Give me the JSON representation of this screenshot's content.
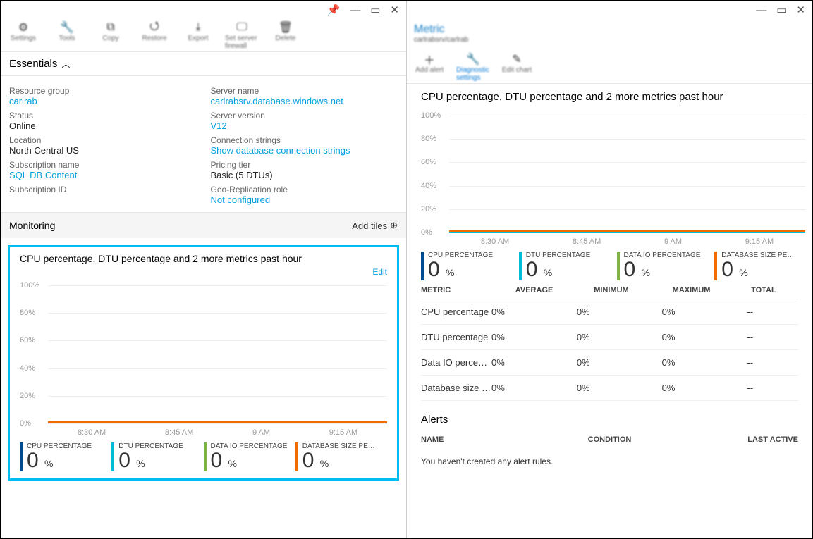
{
  "left": {
    "toolbar": [
      {
        "label": "Settings",
        "icon": "⚙"
      },
      {
        "label": "Tools",
        "icon": "🔧"
      },
      {
        "label": "Copy",
        "icon": "⧉"
      },
      {
        "label": "Restore",
        "icon": "⭯"
      },
      {
        "label": "Export",
        "icon": "⤓"
      },
      {
        "label": "Set server firewall",
        "icon": "🖵"
      },
      {
        "label": "Delete",
        "icon": "🗑"
      }
    ],
    "essentials_label": "Essentials",
    "essentials": {
      "left": [
        {
          "label": "Resource group",
          "value": "carlrab",
          "link": true
        },
        {
          "label": "Status",
          "value": "Online"
        },
        {
          "label": "Location",
          "value": "North Central US"
        },
        {
          "label": "Subscription name",
          "value": "SQL DB Content",
          "link": true
        },
        {
          "label": "Subscription ID",
          "value": ""
        }
      ],
      "right": [
        {
          "label": "Server name",
          "value": "carlrabsrv.database.windows.net",
          "link": true
        },
        {
          "label": "Server version",
          "value": "V12",
          "link": true
        },
        {
          "label": "Connection strings",
          "value": "Show database connection strings",
          "link": true
        },
        {
          "label": "Pricing tier",
          "value": "Basic (5 DTUs)"
        },
        {
          "label": "Geo-Replication role",
          "value": "Not configured",
          "link": true
        }
      ]
    },
    "monitoring_label": "Monitoring",
    "add_tiles": "Add tiles",
    "chart_tile_title": "CPU percentage, DTU percentage and 2 more metrics past hour",
    "edit": "Edit"
  },
  "right": {
    "blade_title": "Metric",
    "blade_sub": "carlrabsrv/carlrab",
    "toolbar": [
      {
        "label": "Add alert",
        "icon": "＋",
        "active": false
      },
      {
        "label": "Diagnostic settings",
        "icon": "🔧",
        "active": true
      },
      {
        "label": "Edit chart",
        "icon": "✎",
        "active": false
      }
    ],
    "chart_title": "CPU percentage, DTU percentage and 2 more metrics past hour",
    "table": {
      "headers": [
        "METRIC",
        "AVERAGE",
        "MINIMUM",
        "MAXIMUM",
        "TOTAL"
      ],
      "rows": [
        [
          "CPU percentage",
          "0%",
          "0%",
          "0%",
          "--"
        ],
        [
          "DTU percentage",
          "0%",
          "0%",
          "0%",
          "--"
        ],
        [
          "Data IO percenta...",
          "0%",
          "0%",
          "0%",
          "--"
        ],
        [
          "Database size pe...",
          "0%",
          "0%",
          "0%",
          "--"
        ]
      ]
    },
    "alerts_label": "Alerts",
    "alerts_headers": [
      "NAME",
      "CONDITION",
      "LAST ACTIVE"
    ],
    "alerts_empty": "You haven't created any alert rules."
  },
  "chart_data": {
    "type": "line",
    "title": "CPU percentage, DTU percentage and 2 more metrics past hour",
    "ylabel": "%",
    "ylim": [
      0,
      100
    ],
    "yticks": [
      "0%",
      "20%",
      "40%",
      "60%",
      "80%",
      "100%"
    ],
    "x": [
      "8:30 AM",
      "8:45 AM",
      "9 AM",
      "9:15 AM"
    ],
    "series": [
      {
        "name": "CPU PERCENTAGE",
        "color": "#004b8d",
        "current": "0",
        "unit": "%",
        "values": [
          0,
          0,
          0,
          0
        ]
      },
      {
        "name": "DTU PERCENTAGE",
        "color": "#00bcd4",
        "current": "0",
        "unit": "%",
        "values": [
          0,
          0,
          0,
          0
        ]
      },
      {
        "name": "DATA IO PERCENTAGE",
        "color": "#7cb342",
        "current": "0",
        "unit": "%",
        "values": [
          0,
          0,
          0,
          0
        ]
      },
      {
        "name": "DATABASE SIZE PERCENT...",
        "color": "#ef6c00",
        "current": "0",
        "unit": "%",
        "values": [
          0,
          0,
          0,
          0
        ]
      }
    ]
  }
}
